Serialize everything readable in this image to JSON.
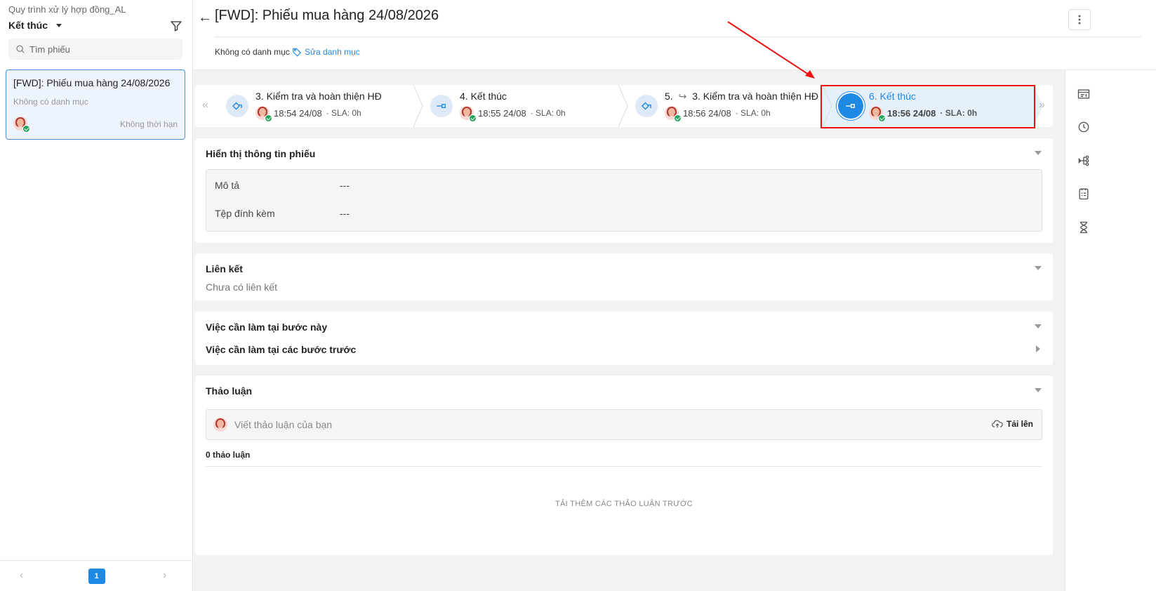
{
  "sidebar": {
    "process_name": "Quy trình xử lý hợp đồng_AL",
    "status_filter": "Kết thúc",
    "search_placeholder": "Tìm phiếu",
    "tickets": [
      {
        "title": "[FWD]: Phiếu mua hàng 24/08/2026",
        "category": "Không có danh mục",
        "deadline": "Không thời hạn"
      }
    ],
    "pager": {
      "prev": "‹",
      "current": "1",
      "next": "›"
    }
  },
  "header": {
    "title": "[FWD]: Phiếu mua hàng 24/08/2026",
    "no_category": "Không có danh mục",
    "edit_category": "Sửa danh mục",
    "more_icon": "more-vertical-icon"
  },
  "stepper": {
    "nav_prev": "«",
    "nav_next": "»",
    "steps": [
      {
        "title": "3. Kiểm tra và hoàn thiện HĐ",
        "time": "18:54 24/08",
        "sla": "· SLA: 0h",
        "icon": "task-hand-icon"
      },
      {
        "title": "4. Kết thúc",
        "time": "18:55 24/08",
        "sla": "· SLA: 0h",
        "icon": "end-node-icon"
      },
      {
        "prefix": "5.",
        "title": "3. Kiểm tra và hoàn thiện HĐ",
        "time": "18:56 24/08",
        "sla": "· SLA: 0h",
        "icon": "task-hand-icon"
      },
      {
        "title": "6. Kết thúc",
        "time": "18:56 24/08",
        "sla": "· SLA: 0h",
        "icon": "end-node-icon",
        "active": true
      }
    ]
  },
  "sections": {
    "info": {
      "title": "Hiển thị thông tin phiếu",
      "rows": [
        {
          "label": "Mô tả",
          "value": "---"
        },
        {
          "label": "Tệp đính kèm",
          "value": "---"
        }
      ]
    },
    "links": {
      "title": "Liên kết",
      "empty": "Chưa có liên kết"
    },
    "todos": {
      "current": "Việc cần làm tại bước này",
      "previous": "Việc cần làm tại các bước trước"
    },
    "discussion": {
      "title": "Thảo luận",
      "placeholder": "Viết thảo luận của bạn",
      "upload": "Tải lên",
      "count": "0 thảo luận",
      "load_more": "TẢI THÊM CÁC THẢO LUẬN TRƯỚC"
    }
  },
  "colors": {
    "accent": "#1e88e5",
    "highlight": "#e11111",
    "success": "#22a45d"
  },
  "right_rail_icons": [
    "detail-panel-icon",
    "history-clock-icon",
    "workflow-icon",
    "checklist-icon",
    "hourglass-icon"
  ]
}
